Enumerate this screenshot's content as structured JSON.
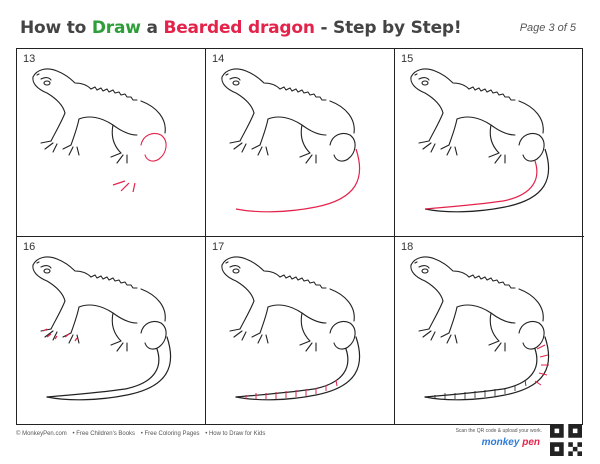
{
  "header": {
    "title_prefix": "How to ",
    "title_draw": "Draw",
    "title_a": " a ",
    "title_subject": "Bearded dragon",
    "title_suffix": " - Step by Step!",
    "page_label": "Page 3 of 5"
  },
  "steps": [
    {
      "number": "13"
    },
    {
      "number": "14"
    },
    {
      "number": "15"
    },
    {
      "number": "16"
    },
    {
      "number": "17"
    },
    {
      "number": "18"
    }
  ],
  "footer": {
    "links": [
      "© MonkeyPen.com",
      "• Free Children's Books",
      "• Free Coloring Pages",
      "• How to Draw for Kids"
    ],
    "scan_text": "Scan the QR code & upload your work.",
    "brand_a": "monkey",
    "brand_b": "pen"
  },
  "colors": {
    "green": "#2e9e3a",
    "red": "#e4234b",
    "ink": "#222222"
  }
}
